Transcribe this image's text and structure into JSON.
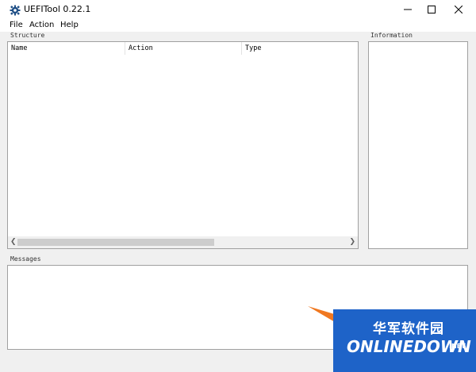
{
  "window": {
    "title": "UEFITool 0.22.1"
  },
  "menu": {
    "file": "File",
    "action": "Action",
    "help": "Help"
  },
  "structure": {
    "label": "Structure",
    "columns": [
      "Name",
      "Action",
      "Type"
    ]
  },
  "information": {
    "label": "Information"
  },
  "messages": {
    "label": "Messages"
  },
  "watermark": {
    "cn_text": "华军软件园",
    "en_text": "ONLINEDOWN",
    "en_suffix": ".NET"
  },
  "colors": {
    "watermark_blue": "#1e63c8",
    "watermark_orange": "#f07820"
  },
  "icons": {
    "app": "gear-icon",
    "minimize": "minimize-icon",
    "maximize": "maximize-icon",
    "close": "close-icon"
  }
}
